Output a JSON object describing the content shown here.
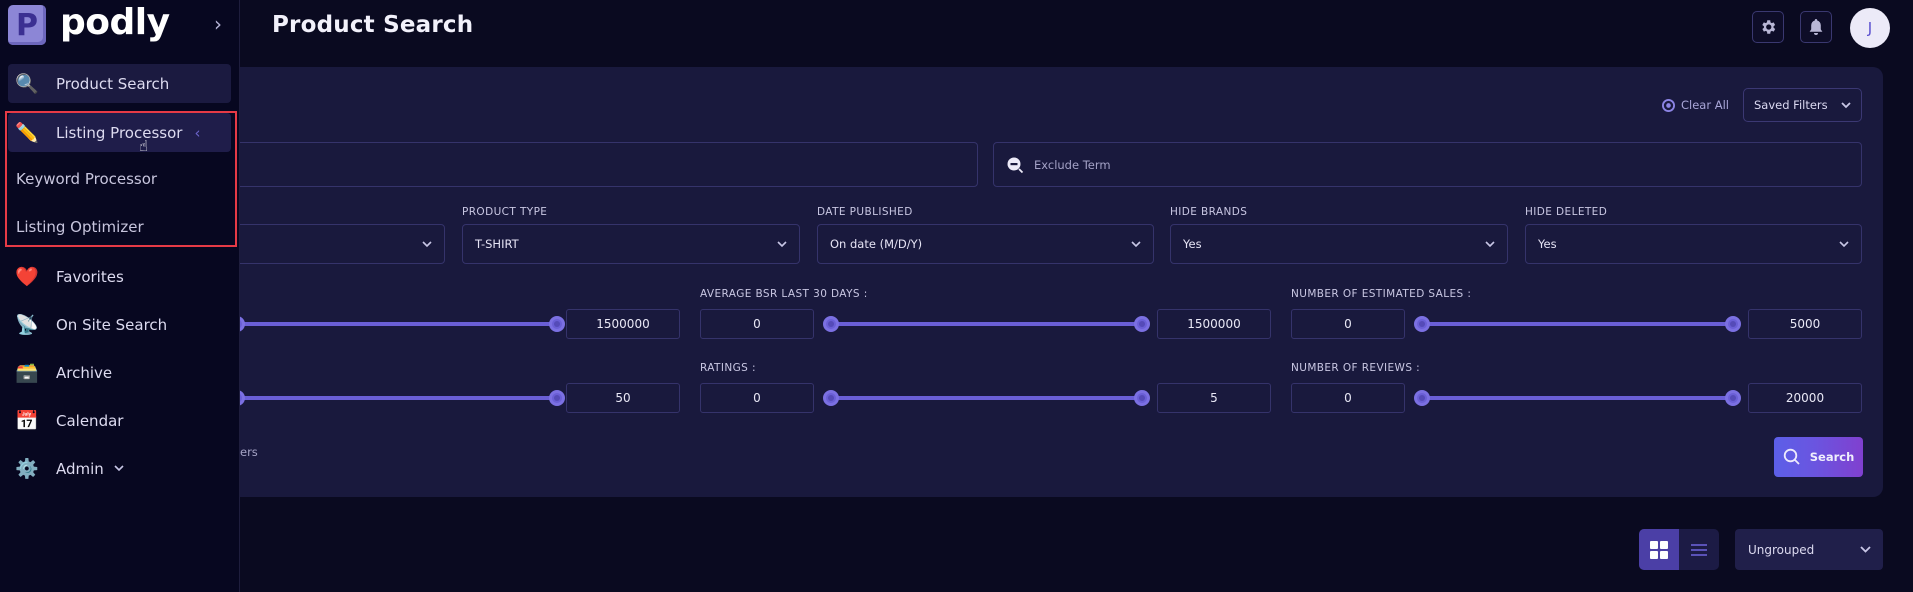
{
  "app": {
    "brand": "podly",
    "logo_letter": "P"
  },
  "header": {
    "title": "Product Search",
    "avatar_initial": "J",
    "icons": [
      "gear-icon",
      "bell-icon"
    ]
  },
  "sidebar": {
    "items": [
      {
        "label": "Product Search",
        "icon": "magnifier-icon",
        "glyph": "🔍"
      },
      {
        "label": "Listing Processor",
        "icon": "pencil-icon",
        "glyph": "✏️",
        "expanded": true
      },
      {
        "label": "Favorites",
        "icon": "heart-icon",
        "glyph": "❤️"
      },
      {
        "label": "On Site Search",
        "icon": "satellite-dish-icon",
        "glyph": "📡"
      },
      {
        "label": "Archive",
        "icon": "archive-box-icon",
        "glyph": "🗃️"
      },
      {
        "label": "Calendar",
        "icon": "calendar-icon",
        "glyph": "📅"
      },
      {
        "label": "Admin",
        "icon": "gear-icon",
        "glyph": "⚙️"
      }
    ],
    "subitems": [
      {
        "label": "Keyword Processor"
      },
      {
        "label": "Listing Optimizer"
      }
    ]
  },
  "filters": {
    "clear_all": "Clear All",
    "saved_filters": "Saved Filters",
    "keyword_input": {
      "value": "",
      "placeholder": ""
    },
    "exclude_input": {
      "value": "",
      "placeholder": "Exclude Term"
    },
    "selects": [
      {
        "label": "",
        "value": ""
      },
      {
        "label": "PRODUCT TYPE",
        "value": "T-SHIRT"
      },
      {
        "label": "DATE PUBLISHED",
        "value": "On date (M/D/Y)"
      },
      {
        "label": "HIDE BRANDS",
        "value": "Yes"
      },
      {
        "label": "HIDE DELETED",
        "value": "Yes"
      }
    ],
    "ranges": [
      {
        "label": "",
        "min": "",
        "max": "1500000",
        "low_fraction": 0,
        "high_fraction": 1
      },
      {
        "label": "AVERAGE BSR LAST 30 DAYS :",
        "min": "0",
        "max": "1500000",
        "low_fraction": 0,
        "high_fraction": 1
      },
      {
        "label": "NUMBER OF ESTIMATED SALES :",
        "min": "0",
        "max": "5000",
        "low_fraction": 0,
        "high_fraction": 1
      },
      {
        "label": "",
        "min": "",
        "max": "50",
        "low_fraction": 0,
        "high_fraction": 1
      },
      {
        "label": "RATINGS :",
        "min": "0",
        "max": "5",
        "low_fraction": 0,
        "high_fraction": 1
      },
      {
        "label": "NUMBER OF REVIEWS :",
        "min": "0",
        "max": "20000",
        "low_fraction": 0,
        "high_fraction": 1
      }
    ],
    "trailing_text": "ers",
    "search_button": "Search"
  },
  "results_toolbar": {
    "view_modes": [
      "grid",
      "list"
    ],
    "active_view": "grid",
    "grouping": "Ungrouped"
  },
  "colors": {
    "accent": "#6a5fd6",
    "panel": "#19193d",
    "background": "#0a0a20",
    "highlight": "#e63a46"
  }
}
